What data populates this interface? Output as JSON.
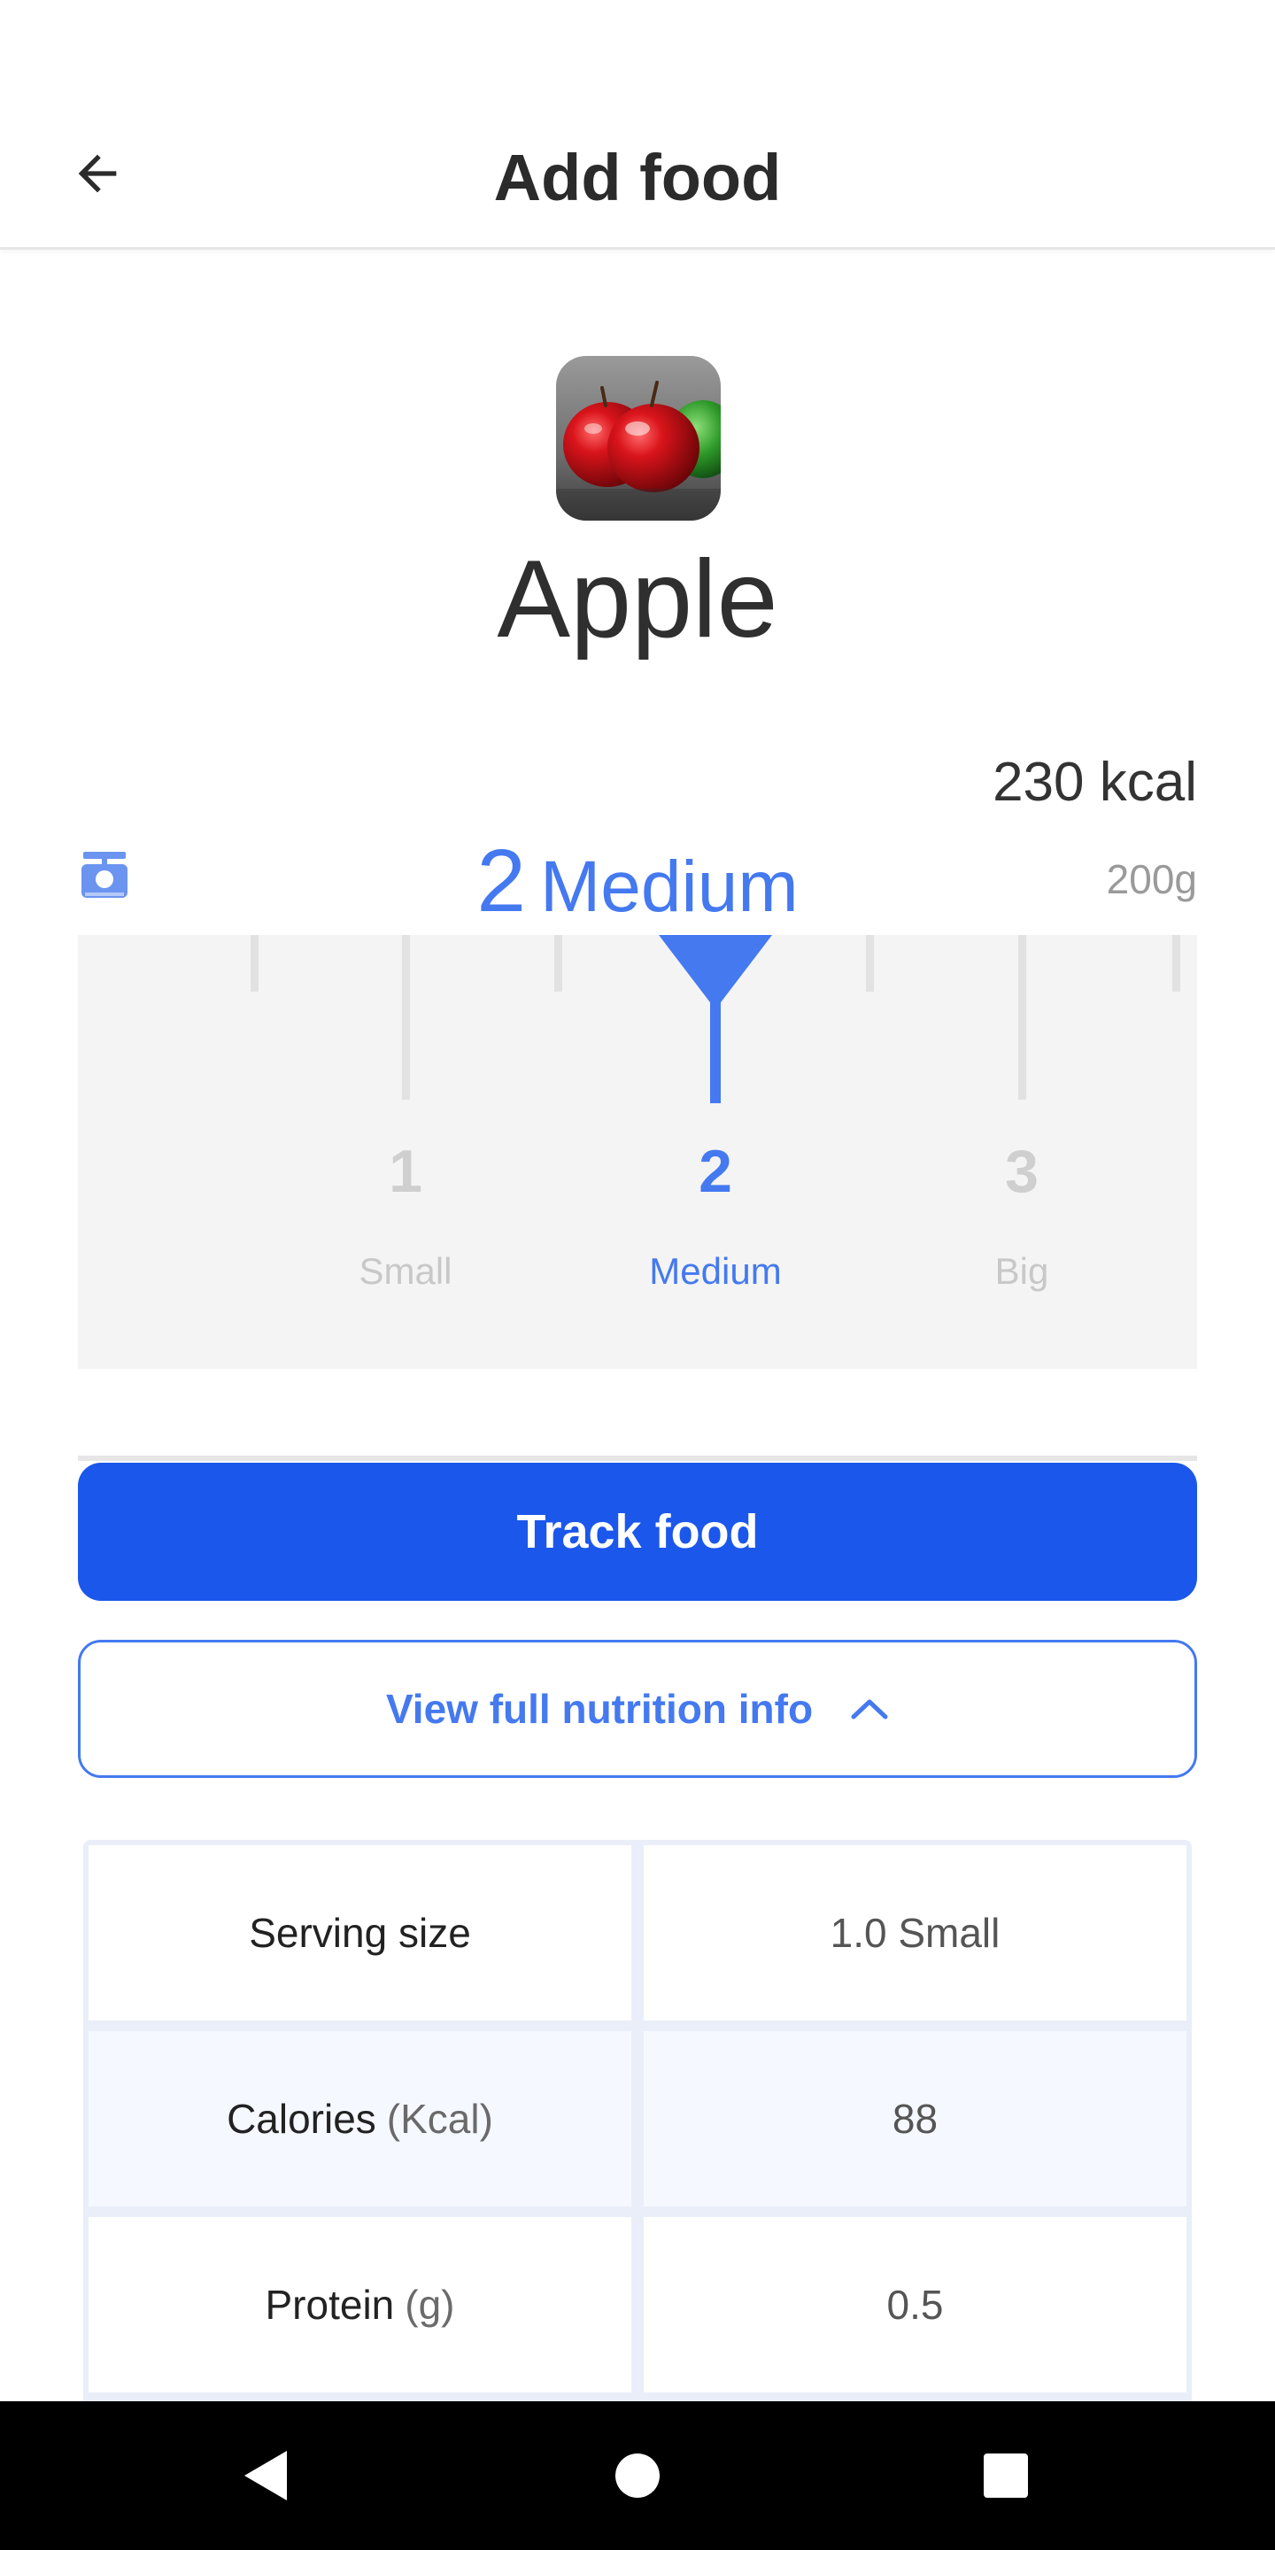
{
  "app_bar": {
    "title": "Add food",
    "back_icon": "arrow-left-icon"
  },
  "food": {
    "name": "Apple",
    "image": "apple-photo"
  },
  "portion": {
    "kcal": "230 kcal",
    "grams": "200g",
    "selected_count": "2",
    "selected_label": "Medium",
    "scale_icon": "kitchen-scale-icon"
  },
  "ruler": {
    "options": [
      {
        "number": "1",
        "label": "Small"
      },
      {
        "number": "2",
        "label": "Medium"
      },
      {
        "number": "3",
        "label": "Big"
      }
    ],
    "selected_index": 1
  },
  "actions": {
    "track_label": "Track food",
    "nutrition_label": "View full nutrition info",
    "nutrition_icon": "chevron-up-icon"
  },
  "nutrition": {
    "rows": [
      {
        "name": "Serving size",
        "unit": "",
        "value": "1.0 Small"
      },
      {
        "name": "Calories",
        "unit": "(Kcal)",
        "value": "88"
      },
      {
        "name": "Protein",
        "unit": "(g)",
        "value": "0.5"
      }
    ]
  },
  "nav": {
    "back_icon": "nav-back-icon",
    "home_icon": "nav-home-icon",
    "recents_icon": "nav-recents-icon"
  },
  "colors": {
    "accent": "#4479F0",
    "primary_button": "#1B57EB",
    "nav_bar": "#000000"
  }
}
